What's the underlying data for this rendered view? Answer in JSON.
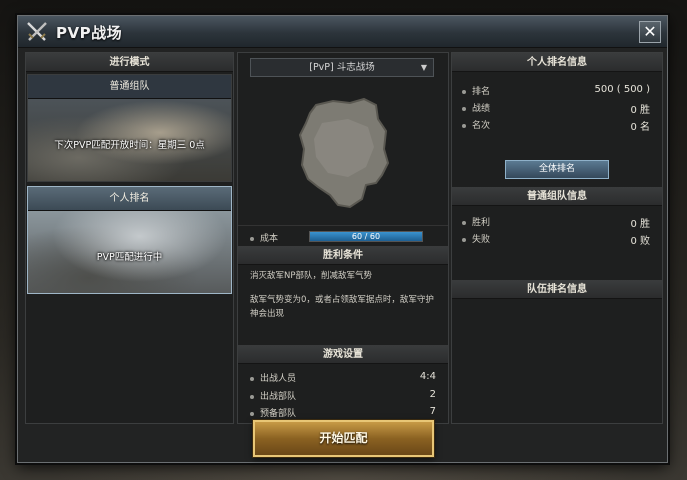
{
  "window": {
    "title": "PVP战场",
    "close_symbol": "✕"
  },
  "left_panel": {
    "header": "进行模式",
    "modes": [
      {
        "title": "普通组队",
        "text": "下次PVP匹配开放时间：星期三 0点"
      },
      {
        "title": "个人排名",
        "text": "PVP匹配进行中"
      }
    ]
  },
  "middle_panel": {
    "dropdown_value": "[PvP] 斗志战场",
    "cost_label": "成本",
    "cost_value": "60 / 60",
    "cost_fraction": 1.0,
    "victory_header": "胜利条件",
    "victory_line1": "消灭敌军NP部队，削减敌军气势",
    "victory_line2": "敌军气势变为0，或者占领敌军据点时，敌军守护神会出现",
    "settings_header": "游戏设置",
    "settings": [
      {
        "label": "出战人员",
        "value": "4:4"
      },
      {
        "label": "出战部队",
        "value": "2"
      },
      {
        "label": "预备部队",
        "value": "7"
      }
    ]
  },
  "right_panel": {
    "personal_header": "个人排名信息",
    "personal_rows": [
      {
        "label": "排名",
        "value": "500 ( 500 )"
      },
      {
        "label": "战绩",
        "value": "0 胜"
      },
      {
        "label": "名次",
        "value": "0 名"
      }
    ],
    "all_rank_button": "全体排名",
    "team_header": "普通组队信息",
    "team_rows": [
      {
        "label": "胜利",
        "value": "0 胜"
      },
      {
        "label": "失败",
        "value": "0 败"
      }
    ],
    "squad_header": "队伍排名信息"
  },
  "start_button": "开始匹配",
  "colors": {
    "accent_blue": "#3a93cf",
    "gold_button": "#c79a46",
    "panel_bg": "#1e1f1f"
  },
  "icons": {
    "title": "crossed-swords-icon",
    "close": "close-icon",
    "dropdown": "chevron-down-icon"
  }
}
